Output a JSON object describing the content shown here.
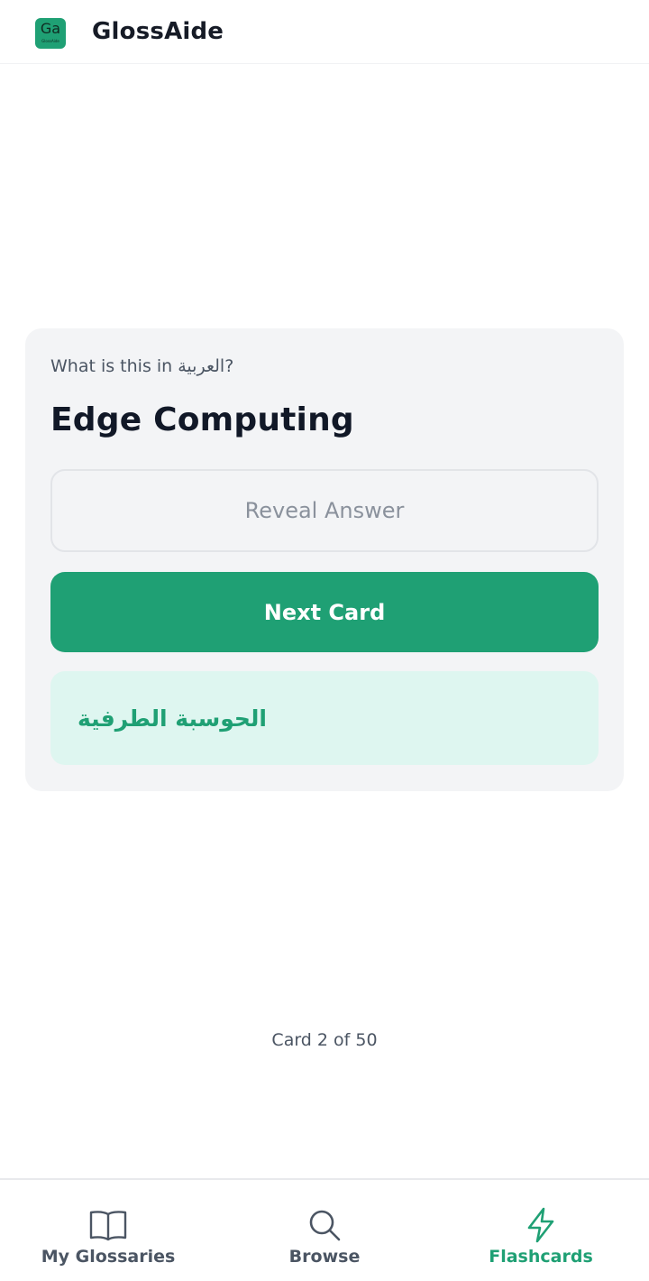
{
  "header": {
    "logo": {
      "mark": "Ga",
      "sub": "GlossAide"
    },
    "title": "GlossAide"
  },
  "flashcard": {
    "prompt": "What is this in العربية?",
    "term": "Edge Computing",
    "reveal_label": "Reveal Answer",
    "next_label": "Next Card",
    "answer": "الحوسبة الطرفية"
  },
  "progress": {
    "text": "Card 2 of 50",
    "current": 2,
    "total": 50
  },
  "nav": {
    "items": [
      {
        "label": "My Glossaries",
        "icon": "book-open-icon",
        "active": false
      },
      {
        "label": "Browse",
        "icon": "search-icon",
        "active": false
      },
      {
        "label": "Flashcards",
        "icon": "lightning-icon",
        "active": true
      }
    ]
  },
  "colors": {
    "accent": "#1fa074",
    "answer_bg": "#def6f0",
    "card_bg": "#f3f4f6",
    "inactive_text": "#4b5563"
  }
}
